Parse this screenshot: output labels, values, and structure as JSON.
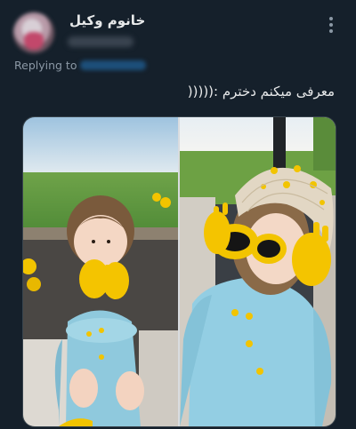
{
  "tweet": {
    "author_name": "خانوم وکیل",
    "author_handle": "",
    "replying_to_label": "Replying to",
    "replying_to_handle": "",
    "text": "معرفی میکنم دخترم :(((((",
    "more_icon": "more-vertical-icon"
  },
  "media": {
    "photos": [
      {
        "name": "photo-left",
        "description": ""
      },
      {
        "name": "photo-right",
        "description": ""
      }
    ]
  },
  "colors": {
    "background": "#15202b",
    "text_primary": "#e7e9ea",
    "text_secondary": "#8b98a5",
    "accent": "#1d9bf0"
  }
}
